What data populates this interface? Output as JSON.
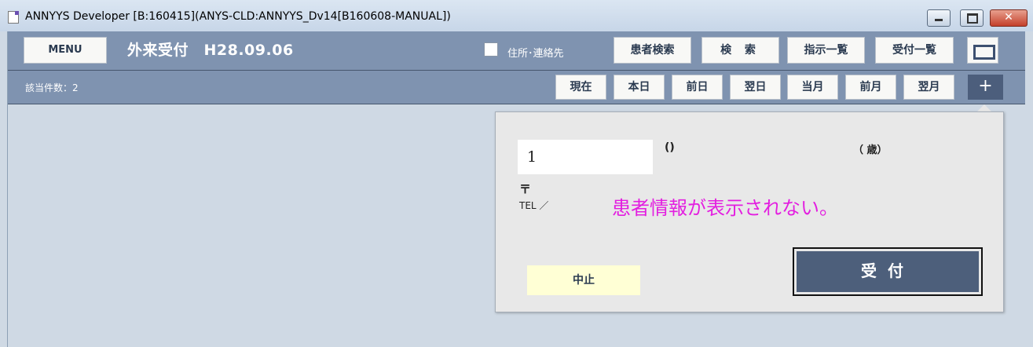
{
  "window": {
    "title": "ANNYYS Developer [B:160415](ANYS-CLD:ANNYYS_Dv14[B160608-MANUAL])",
    "controls": {
      "minimize": "minimize",
      "maximize": "maximize",
      "close": "✕"
    }
  },
  "toolbar": {
    "menu_label": "MENU",
    "screen_title": "外来受付　H28.09.06",
    "address_checkbox_label": "住所･連絡先",
    "buttons": {
      "patient_search": "患者検索",
      "search": "検 索",
      "instruction_list": "指示一覧",
      "reception_list": "受付一覧"
    }
  },
  "subbar": {
    "count_label": "該当件数：2",
    "date_buttons": [
      "現在",
      "本日",
      "前日",
      "翌日",
      "当月",
      "前月",
      "翌月"
    ],
    "plus_label": "+"
  },
  "popup": {
    "patient_id_value": "1",
    "name_paren": "()",
    "age_label": "（ 歳）",
    "postal_mark": "〒",
    "tel_label": "TEL ／",
    "annotation": "患者情報が表示されない。",
    "cancel_label": "中止",
    "accept_label": "受付"
  },
  "colors": {
    "toolbar_bg": "#7f93b0",
    "accent_dark": "#4d5f7b",
    "annotation": "#e31ee0",
    "cancel_bg": "#ffffd5",
    "content_bg": "#cfd9e4"
  }
}
